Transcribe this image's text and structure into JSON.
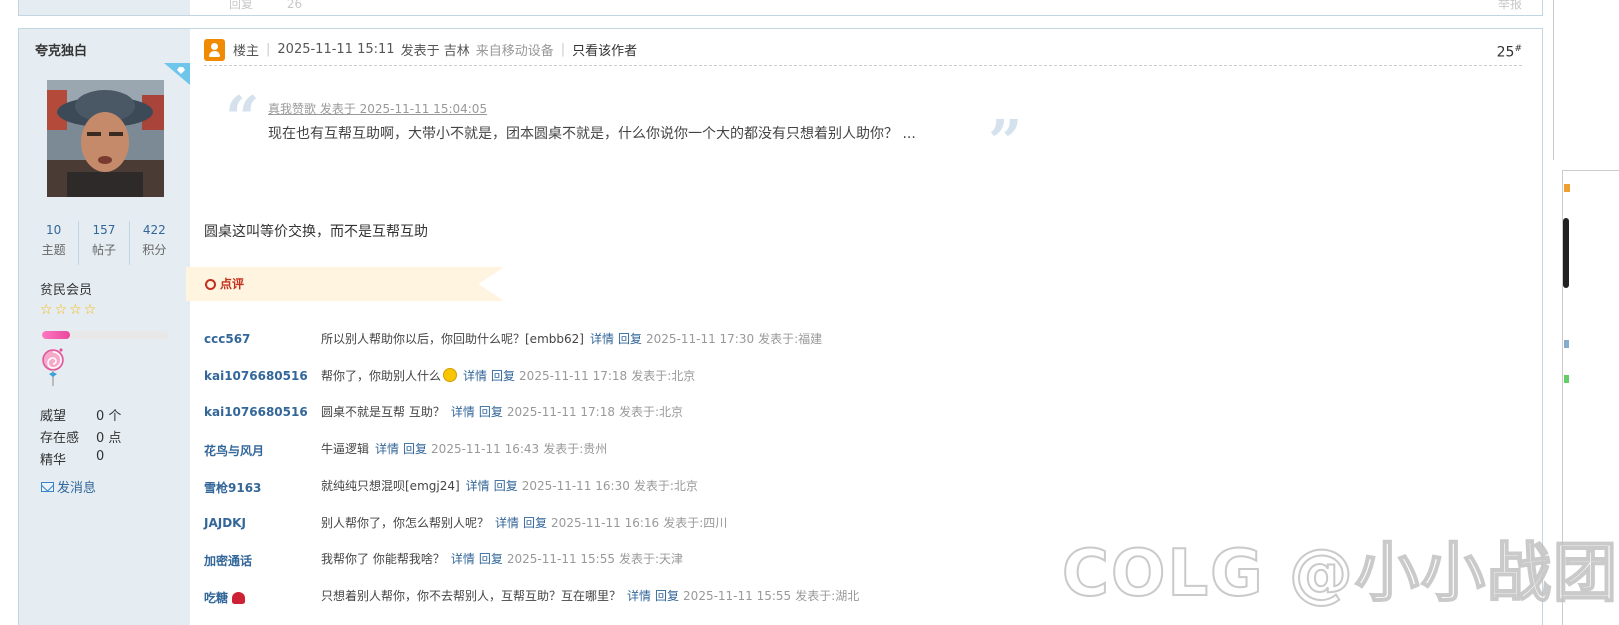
{
  "previous_post": {
    "reply_label": "回复",
    "count": "26",
    "report_label": "举报"
  },
  "author": {
    "name": "夸克独白",
    "stats": [
      {
        "value": "10",
        "label": "主题"
      },
      {
        "value": "157",
        "label": "帖子"
      },
      {
        "value": "422",
        "label": "积分"
      }
    ],
    "group": "贫民会员",
    "star_count": 4,
    "level_progress_percent": 22,
    "info": [
      {
        "label": "威望",
        "value": "0 个"
      },
      {
        "label": "存在感",
        "value": "0 点"
      },
      {
        "label": "精华",
        "value": "0"
      }
    ],
    "send_message": "发消息"
  },
  "post": {
    "owner_label": "楼主",
    "date": "2025-11-11 15:11",
    "posted_in": "发表于 吉林",
    "from_device": "来自移动设备",
    "only_author": "只看该作者",
    "floor_number": "25",
    "floor_suffix": "#",
    "quote": {
      "meta": "真我赞歌 发表于 2025-11-11 15:04:05",
      "text": "现在也有互帮互助啊，大带小不就是，团本圆桌不就是，什么你说你一个大的都没有只想着别人助你？ ..."
    },
    "reply": "圆桌这叫等价交换，而不是互帮互助"
  },
  "comments_section": {
    "title": "点评",
    "detail_label": "详情",
    "reply_label": "回复",
    "items": [
      {
        "user": "ccc567",
        "text": "所以别人帮助你以后，你回助什么呢？[embb62]",
        "time": "2025-11-11 17:30",
        "location": "发表于:福建"
      },
      {
        "user": "kai1076680516",
        "text": "帮你了，你助别人什么",
        "time": "2025-11-11 17:18",
        "location": "发表于:北京",
        "emoji": true
      },
      {
        "user": "kai1076680516",
        "text": "圆桌不就是互帮 互助？",
        "time": "2025-11-11 17:18",
        "location": "发表于:北京"
      },
      {
        "user": "花鸟与风月",
        "text": "牛逼逻辑",
        "time": "2025-11-11 16:43",
        "location": "发表于:贵州"
      },
      {
        "user": "雪枪9163",
        "text": "就纯纯只想混呗[emgj24]",
        "time": "2025-11-11 16:30",
        "location": "发表于:北京"
      },
      {
        "user": "JAJDKJ",
        "text": "别人帮你了，你怎么帮别人呢？",
        "time": "2025-11-11 16:16",
        "location": "发表于:四川"
      },
      {
        "user": "加密通话",
        "text": "我帮你了 你能帮我啥？",
        "time": "2025-11-11 15:55",
        "location": "发表于:天津"
      },
      {
        "user": "吃糖",
        "text": "只想着别人帮你，你不去帮别人，互帮互助？互在哪里？",
        "time": "2025-11-11 15:55",
        "location": "发表于:湖北",
        "badge": true
      }
    ]
  },
  "watermark": "COLG @小小战团",
  "colors": {
    "sidebar_bg": "#e5edf2",
    "border": "#c2d5e3",
    "link": "#336699",
    "accent_orange": "#f08a00",
    "comment_red": "#c4301c"
  }
}
